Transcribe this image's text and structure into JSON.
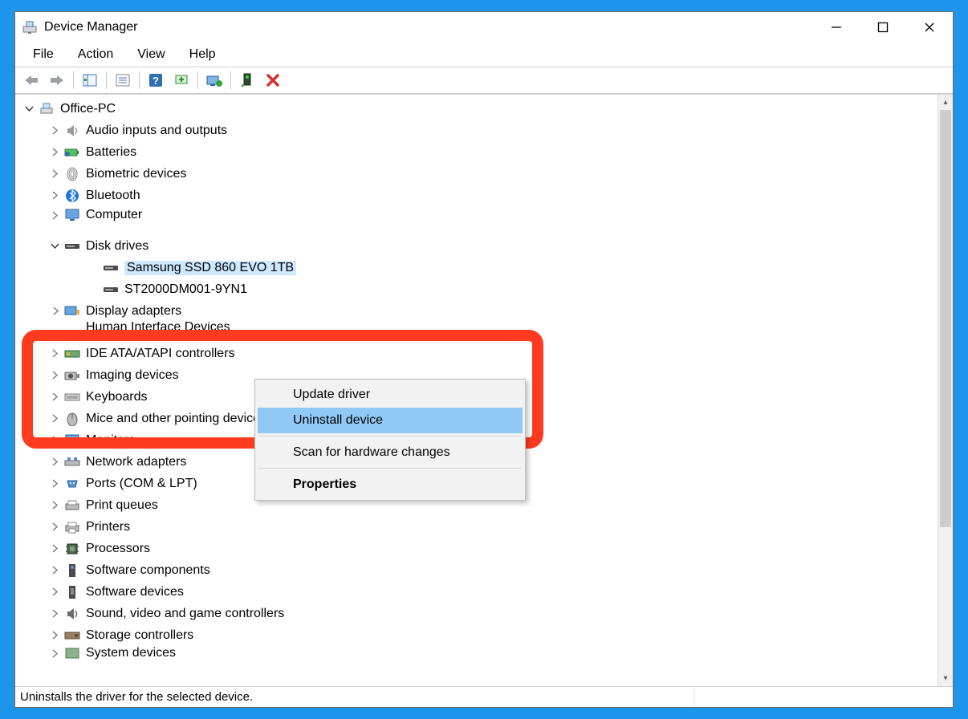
{
  "window": {
    "title": "Device Manager"
  },
  "menubar": [
    "File",
    "Action",
    "View",
    "Help"
  ],
  "toolbar_icons": [
    "back-icon",
    "forward-icon",
    "show-hidden-icon",
    "properties-icon",
    "help-icon",
    "update-driver-icon",
    "monitor-icon",
    "uninstall-icon",
    "delete-icon"
  ],
  "tree": {
    "root": {
      "label": "Office-PC",
      "expanded": true
    },
    "nodes": [
      {
        "label": "Audio inputs and outputs",
        "icon": "speaker-icon",
        "expanded": false,
        "children": []
      },
      {
        "label": "Batteries",
        "icon": "battery-icon",
        "expanded": false,
        "children": []
      },
      {
        "label": "Biometric devices",
        "icon": "fingerprint-icon",
        "expanded": false,
        "children": []
      },
      {
        "label": "Bluetooth",
        "icon": "bluetooth-icon",
        "expanded": false,
        "children": []
      },
      {
        "label": "Computer",
        "icon": "monitor-icon",
        "expanded": false,
        "children": []
      },
      {
        "label": "Disk drives",
        "icon": "disk-icon",
        "expanded": true,
        "children": [
          {
            "label": "Samsung SSD 860 EVO 1TB",
            "icon": "disk-icon",
            "selected": true
          },
          {
            "label": "ST2000DM001-9YN1",
            "icon": "disk-icon"
          }
        ]
      },
      {
        "label": "Display adapters",
        "icon": "display-adapter-icon",
        "expanded": false,
        "children": []
      },
      {
        "label": "Human Interface Devices",
        "icon": "hid-icon",
        "expanded": false,
        "children": [],
        "partially_hidden": true
      },
      {
        "label": "IDE ATA/ATAPI controllers",
        "icon": "ide-icon",
        "expanded": false,
        "children": []
      },
      {
        "label": "Imaging devices",
        "icon": "camera-icon",
        "expanded": false,
        "children": []
      },
      {
        "label": "Keyboards",
        "icon": "keyboard-icon",
        "expanded": false,
        "children": []
      },
      {
        "label": "Mice and other pointing devices",
        "icon": "mouse-icon",
        "expanded": false,
        "children": []
      },
      {
        "label": "Monitors",
        "icon": "monitor-icon",
        "expanded": false,
        "children": []
      },
      {
        "label": "Network adapters",
        "icon": "network-icon",
        "expanded": false,
        "children": []
      },
      {
        "label": "Ports (COM & LPT)",
        "icon": "port-icon",
        "expanded": false,
        "children": []
      },
      {
        "label": "Print queues",
        "icon": "printqueue-icon",
        "expanded": false,
        "children": []
      },
      {
        "label": "Printers",
        "icon": "printer-icon",
        "expanded": false,
        "children": []
      },
      {
        "label": "Processors",
        "icon": "cpu-icon",
        "expanded": false,
        "children": []
      },
      {
        "label": "Software components",
        "icon": "sw-component-icon",
        "expanded": false,
        "children": []
      },
      {
        "label": "Software devices",
        "icon": "sw-device-icon",
        "expanded": false,
        "children": []
      },
      {
        "label": "Sound, video and game controllers",
        "icon": "sound-icon",
        "expanded": false,
        "children": []
      },
      {
        "label": "Storage controllers",
        "icon": "storage-icon",
        "expanded": false,
        "children": []
      },
      {
        "label": "System devices",
        "icon": "system-icon",
        "expanded": false,
        "children": []
      }
    ]
  },
  "context_menu": {
    "items": [
      {
        "label": "Update driver"
      },
      {
        "label": "Uninstall device",
        "highlighted": true
      },
      {
        "separator": true
      },
      {
        "label": "Scan for hardware changes"
      },
      {
        "separator": true
      },
      {
        "label": "Properties",
        "bold": true
      }
    ]
  },
  "statusbar": {
    "text": "Uninstalls the driver for the selected device."
  },
  "colors": {
    "selection": "#cde8ff",
    "menu_highlight": "#90c8f6",
    "annotation_red": "#ff3b1f",
    "desktop_blue": "#1c95ea"
  }
}
